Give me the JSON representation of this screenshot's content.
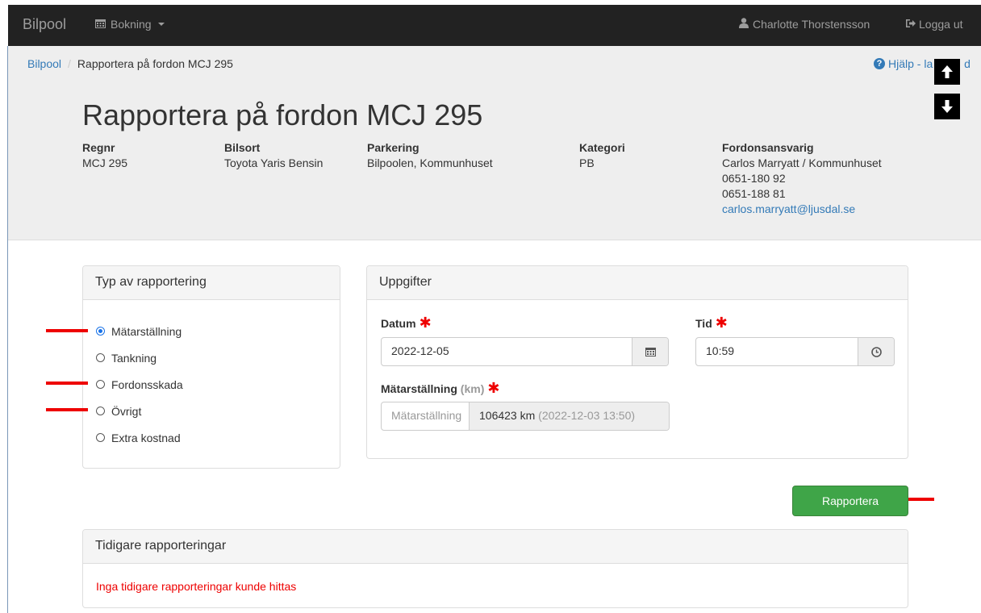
{
  "navbar": {
    "brand": "Bilpool",
    "booking_label": "Bokning",
    "user_name": "Charlotte Thorstensson",
    "logout_label": "Logga ut"
  },
  "breadcrumb": {
    "root": "Bilpool",
    "separator": "/",
    "current": "Rapportera på fordon MCJ 295"
  },
  "help_link": "Hjälp - la          d",
  "page_title": "Rapportera på fordon MCJ 295",
  "vehicle": {
    "regnr_label": "Regnr",
    "regnr": "MCJ 295",
    "bilsort_label": "Bilsort",
    "bilsort": "Toyota Yaris Bensin",
    "parkering_label": "Parkering",
    "parkering": "Bilpoolen, Kommunhuset",
    "kategori_label": "Kategori",
    "kategori": "PB",
    "ansvarig_label": "Fordonsansvarig",
    "ansvarig_name": "Carlos Marryatt / Kommunhuset",
    "phone1": "0651-180 92",
    "phone2": "0651-188 81",
    "email": "carlos.marryatt@ljusdal.se"
  },
  "type_panel": {
    "title": "Typ av rapportering",
    "options": [
      "Mätarställning",
      "Tankning",
      "Fordonsskada",
      "Övrigt",
      "Extra kostnad"
    ],
    "selected": "Mätarställning"
  },
  "details_panel": {
    "title": "Uppgifter",
    "date_label": "Datum",
    "date_value": "2022-12-05",
    "time_label": "Tid",
    "time_value": "10:59",
    "odometer_label": "Mätarställning",
    "odometer_unit": "(km)",
    "odometer_placeholder": "Mätarställning",
    "odometer_last_value": "106423 km",
    "odometer_last_time": "(2022-12-03 13:50)",
    "required_mark": "✱"
  },
  "submit_label": "Rapportera",
  "history_panel": {
    "title": "Tidigare rapporteringar",
    "empty_message": "Inga tidigare rapporteringar kunde hittas"
  },
  "colors": {
    "navbar": "#222222",
    "link": "#337ab7",
    "primary_button": "#3fa548",
    "required": "#ee0000"
  }
}
